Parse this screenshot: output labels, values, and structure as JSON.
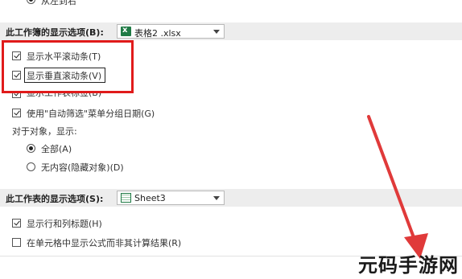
{
  "top_partial": {
    "label": "从左到右"
  },
  "workbook_section": {
    "label": "此工作簿的显示选项(B):",
    "selected_workbook": "表格2 .xlsx",
    "options": [
      {
        "label": "显示水平滚动条(T)",
        "checked": true
      },
      {
        "label": "显示垂直滚动条(V)",
        "checked": true
      },
      {
        "label": "显示工作表标签(B)",
        "checked": true
      },
      {
        "label": "使用\"自动筛选\"菜单分组日期(G)",
        "checked": true
      }
    ],
    "objects_label": "对于对象，显示:",
    "radio_options": [
      {
        "label": "全部(A)",
        "checked": true
      },
      {
        "label": "无内容(隐藏对象)(D)",
        "checked": false
      }
    ]
  },
  "worksheet_section": {
    "label": "此工作表的显示选项(S):",
    "selected_sheet": "Sheet3",
    "options": [
      {
        "label": "显示行和列标题(H)",
        "checked": true
      },
      {
        "label": "在单元格中显示公式而非其计算结果(R)",
        "checked": false
      }
    ]
  },
  "watermark": {
    "text": "元码手游网"
  },
  "colors": {
    "highlight": "#e01b1b",
    "arrow": "#e03a3a",
    "section_bg": "#ededed"
  }
}
